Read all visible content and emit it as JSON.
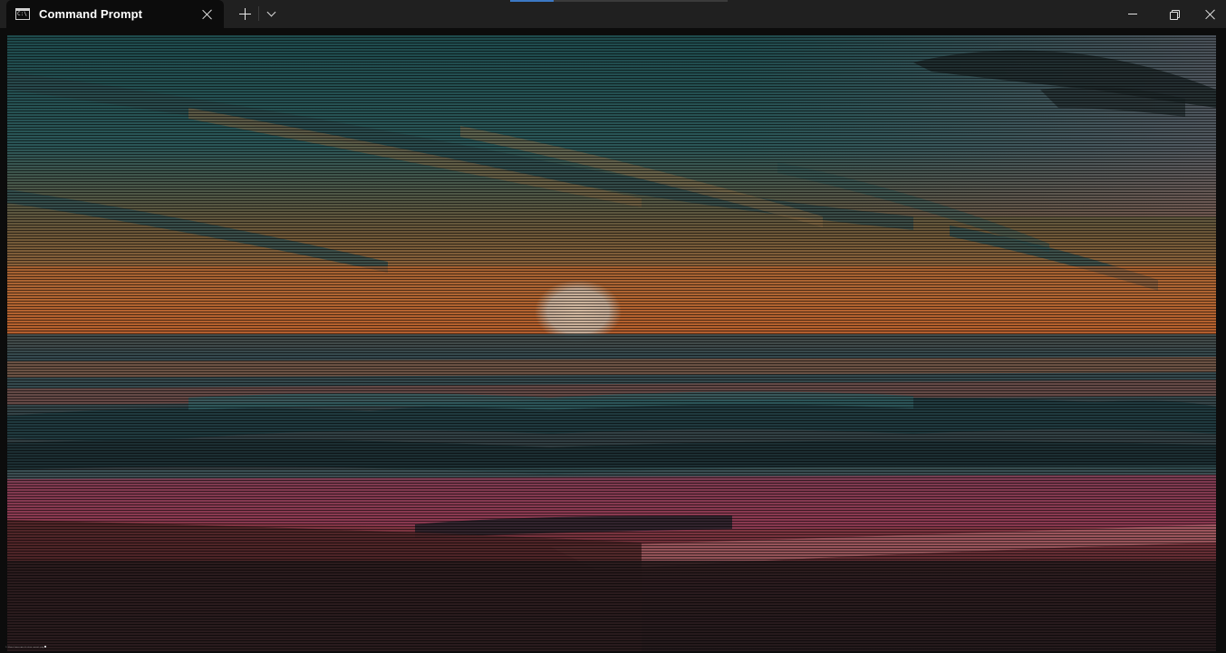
{
  "window": {
    "tab_title": "Command Prompt",
    "tab_icon": "cmd-icon",
    "tab_icon_text": "C:\\",
    "accent_color": "#3b78c4",
    "titlebar_color": "#202020",
    "background_color": "#0c0c0c"
  },
  "tabbar": {
    "new_tab_icon": "plus-icon",
    "dropdown_icon": "chevron-down-icon",
    "close_tab_icon": "close-icon"
  },
  "window_controls": {
    "minimize_icon": "minimize-icon",
    "restore_icon": "restore-icon",
    "close_icon": "close-icon"
  },
  "terminal": {
    "content_description_icon": "ascii-art-image",
    "prompt_text": "C:\\Users\\user>ascii-view sunset.png"
  }
}
